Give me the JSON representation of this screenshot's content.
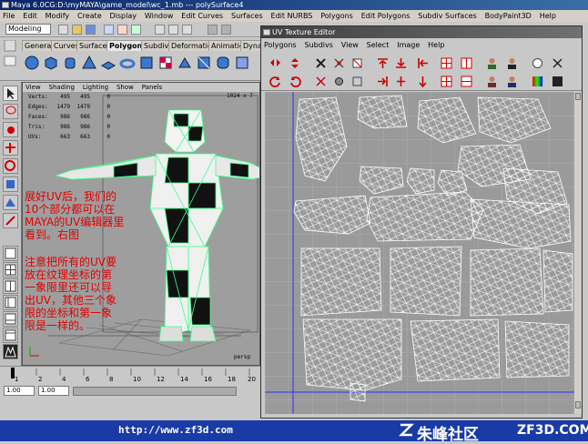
{
  "window": {
    "title": "Maya 6.0CG:D:\\myMAYA\\game_model\\wc_1.mb  ---  polySurface4"
  },
  "menubar": [
    "File",
    "Edit",
    "Modify",
    "Create",
    "Display",
    "Window",
    "Edit Curves",
    "Surfaces",
    "Edit NURBS",
    "Polygons",
    "Edit Polygons",
    "Subdiv Surfaces",
    "BodyPaint3D",
    "Help"
  ],
  "statusline": {
    "mode": "Modeling"
  },
  "shelf": {
    "tabs": [
      "General",
      "Curves",
      "Surfaces",
      "Polygons",
      "Subdivs",
      "Deformation",
      "Animation",
      "Dynam"
    ],
    "active_tab": "Polygons"
  },
  "viewport": {
    "menu": [
      "View",
      "Shading",
      "Lighting",
      "Show",
      "Panels"
    ],
    "hud": [
      {
        "label": "Verts:",
        "a": "495",
        "b": "495",
        "c": "0"
      },
      {
        "label": "Edges:",
        "a": "1479",
        "b": "1479",
        "c": "0"
      },
      {
        "label": "Faces:",
        "a": "986",
        "b": "986",
        "c": "0"
      },
      {
        "label": "Tris:",
        "a": "986",
        "b": "986",
        "c": "0"
      },
      {
        "label": "UVs:",
        "a": "663",
        "b": "663",
        "c": "0"
      }
    ],
    "resolution": "1024 x 7",
    "camera": "persp",
    "note1": [
      "展好UV后，我们的",
      "10个部分都可以在",
      "MAYA的UV编辑器里",
      "看到。右图"
    ],
    "note2": [
      "注意把所有的UV要",
      "放在纹理坐标的第",
      "一象限里还可以导",
      "出UV，其他三个象",
      "限的坐标和第一象",
      "限是一样的。"
    ]
  },
  "timeslider": {
    "ticks": [
      "1",
      "2",
      "4",
      "6",
      "8",
      "10",
      "12",
      "14",
      "16",
      "18",
      "20"
    ],
    "start": "1.00",
    "end": "1.00"
  },
  "uv_editor": {
    "title": "UV Texture Editor",
    "menu": [
      "Polygons",
      "Subdivs",
      "View",
      "Select",
      "Image",
      "Help"
    ]
  },
  "footer": {
    "url": "http://www.zf3d.com",
    "brand": "朱峰社区",
    "brand_en": "ZF3D.COM"
  },
  "colors": {
    "title_blue": "#0a246a",
    "footer_blue": "#1a3aa6",
    "note_red": "#e00000",
    "wire_green": "#3dff8a"
  }
}
